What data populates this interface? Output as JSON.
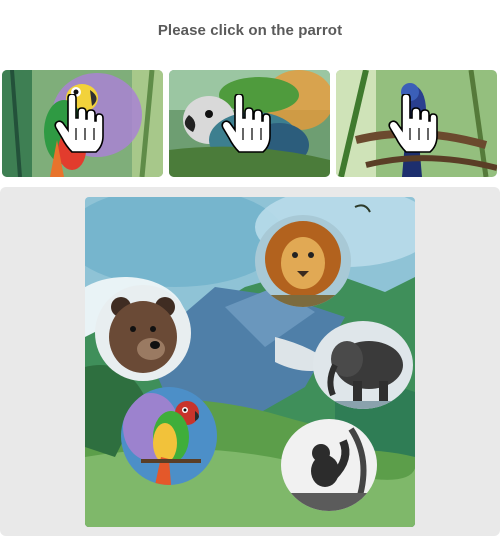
{
  "captcha": {
    "instruction": "Please click on the parrot"
  },
  "examples": [
    {
      "subject": "parrot",
      "icon": "hand-pointer-icon"
    },
    {
      "subject": "parrot",
      "icon": "hand-pointer-icon"
    },
    {
      "subject": "parrot",
      "icon": "hand-pointer-icon"
    }
  ],
  "puzzle": {
    "animals": [
      "lion",
      "bear",
      "elephant",
      "parrot",
      "squirrel"
    ]
  }
}
